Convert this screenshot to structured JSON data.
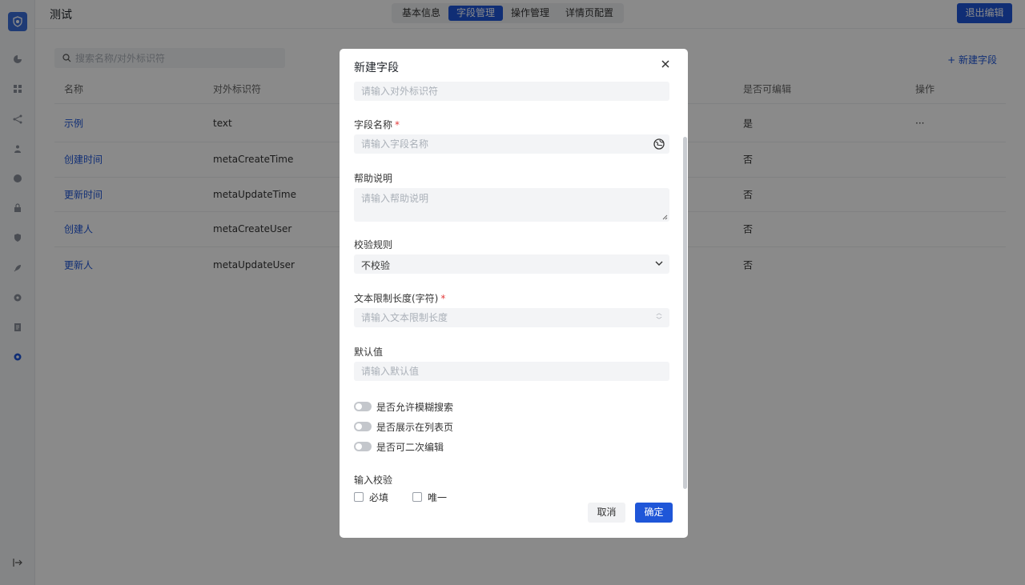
{
  "header": {
    "title": "测试",
    "tabs": [
      {
        "label": "基本信息"
      },
      {
        "label": "字段管理"
      },
      {
        "label": "操作管理"
      },
      {
        "label": "详情页配置"
      }
    ],
    "active_tab": "字段管理",
    "exit_label": "退出编辑"
  },
  "toolbar": {
    "search_placeholder": "搜索名称/对外标识符",
    "new_field_label": "+ 新建字段"
  },
  "table": {
    "headers": {
      "name": "名称",
      "identifier": "对外标识符",
      "editable": "是否可编辑",
      "actions": "操作"
    },
    "rows": [
      {
        "name": "示例",
        "identifier": "text",
        "editable": "是",
        "actions": "···"
      },
      {
        "name": "创建时间",
        "identifier": "metaCreateTime",
        "editable": "否",
        "actions": ""
      },
      {
        "name": "更新时间",
        "identifier": "metaUpdateTime",
        "editable": "否",
        "actions": ""
      },
      {
        "name": "创建人",
        "identifier": "metaCreateUser",
        "editable": "否",
        "actions": ""
      },
      {
        "name": "更新人",
        "identifier": "metaUpdateUser",
        "editable": "否",
        "actions": ""
      }
    ]
  },
  "modal": {
    "title": "新建字段",
    "close_icon": "close-icon",
    "identifier_placeholder": "请输入对外标识符",
    "field_name": {
      "label": "字段名称",
      "required_mark": "*",
      "placeholder": "请输入字段名称"
    },
    "help": {
      "label": "帮助说明",
      "placeholder": "请输入帮助说明"
    },
    "rule": {
      "label": "校验规则",
      "value": "不校验"
    },
    "length": {
      "label": "文本限制长度(字符)",
      "required_mark": "*",
      "placeholder": "请输入文本限制长度"
    },
    "default": {
      "label": "默认值",
      "placeholder": "请输入默认值"
    },
    "switches": [
      {
        "label": "是否允许模糊搜索",
        "on": false
      },
      {
        "label": "是否展示在列表页",
        "on": false
      },
      {
        "label": "是否可二次编辑",
        "on": false
      }
    ],
    "validation": {
      "label": "输入校验",
      "options": [
        {
          "label": "必填",
          "checked": false
        },
        {
          "label": "唯一",
          "checked": false
        }
      ]
    },
    "cancel_label": "取消",
    "ok_label": "确定"
  },
  "colors": {
    "primary": "#1f56d8",
    "required": "#e23b3b",
    "overlay": "rgba(0,0,0,0.46)"
  }
}
